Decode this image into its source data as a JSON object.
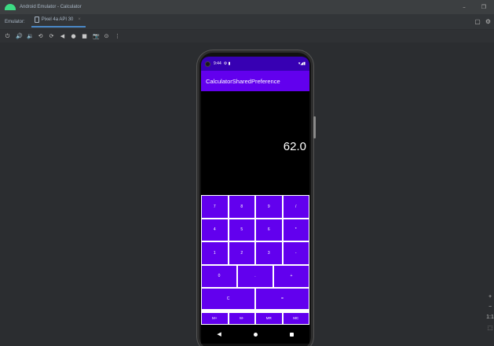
{
  "window": {
    "title": "Android Emulator - Calculator",
    "controls": [
      "–",
      "❐"
    ]
  },
  "tabbar": {
    "emulator_label": "Emulator:",
    "device_tab": "Pixel 4a API 30",
    "close": "×",
    "right_icons": [
      "▢",
      "⚙"
    ]
  },
  "toolbar": {
    "buttons": [
      "⏻",
      "🔊",
      "🔉",
      "⟲",
      "⟳",
      "◀",
      "●",
      "■",
      "📷",
      "⊙",
      "⋮"
    ]
  },
  "phone": {
    "status": {
      "time": "9:44",
      "icons": "⚙ ▮",
      "right": "▾◢▮"
    },
    "app_title": "CalculatorSharedPreference",
    "display_value": "62.0",
    "keypad": {
      "row1": [
        "7",
        "8",
        "9",
        "/"
      ],
      "row2": [
        "4",
        "5",
        "6",
        "*"
      ],
      "row3": [
        "1",
        "2",
        "3",
        "-"
      ],
      "row4": [
        "0",
        ".",
        "+"
      ],
      "row5": [
        "C",
        "="
      ],
      "memory": [
        "M+",
        "M-",
        "MR",
        "MC"
      ]
    },
    "nav": {
      "back": "◀"
    }
  },
  "zoom": {
    "plus": "+",
    "minus": "−",
    "one_to_one": "1:1",
    "fit": "⬚"
  }
}
